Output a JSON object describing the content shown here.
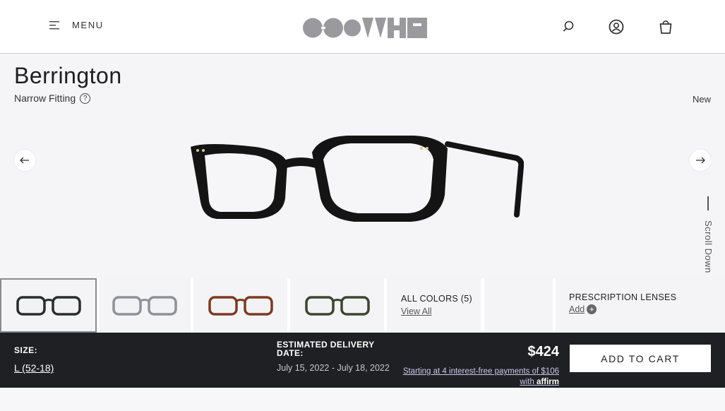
{
  "header": {
    "menu_label": "MENU",
    "logo_alt": "OLIVER PEOPLES"
  },
  "product": {
    "title": "Berrington",
    "fitting": "Narrow Fitting",
    "fitting_help": "?",
    "badge": "New",
    "scroll_hint": "Scroll Down"
  },
  "colors": {
    "thumbs": [
      {
        "frame": "#2b2d2c",
        "lens": "#e8e8ea"
      },
      {
        "frame": "#8d9299",
        "lens": "#e8e8ea"
      },
      {
        "frame": "#7a3b22",
        "lens": "#e8e8ea"
      },
      {
        "frame": "#3f4433",
        "lens": "#e8e8ea"
      }
    ],
    "all_colors_label": "ALL COLORS (5)",
    "view_all": "View All"
  },
  "prescription": {
    "label": "PRESCRIPTION LENSES",
    "add": "Add",
    "plus": "+"
  },
  "purchase": {
    "size_label": "SIZE:",
    "size_value": "L (52-18)",
    "delivery_label": "ESTIMATED DELIVERY DATE:",
    "delivery_value": "July 15, 2022 - July 18, 2022",
    "price": "$424",
    "affirm_text": "Starting at 4 interest-free payments of $106",
    "affirm_with": "with",
    "affirm_brand": "affirm",
    "cart_label": "ADD TO CART"
  }
}
